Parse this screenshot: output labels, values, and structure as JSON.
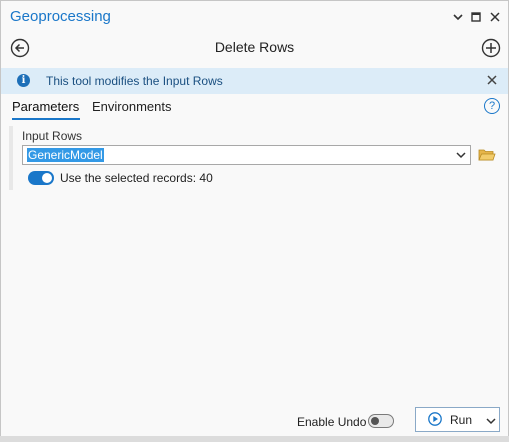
{
  "window": {
    "title": "Geoprocessing",
    "controls": [
      "chevron-down-icon",
      "maximize-icon",
      "close-icon"
    ]
  },
  "header": {
    "tool_title": "Delete Rows",
    "back_icon": "back-arrow-icon",
    "add_icon": "add-circle-icon"
  },
  "info": {
    "message": "This tool modifies the Input Rows",
    "icon": "info-icon"
  },
  "tabs": [
    {
      "label": "Parameters",
      "active": true
    },
    {
      "label": "Environments",
      "active": false
    }
  ],
  "params": {
    "input_rows_label": "Input Rows",
    "input_rows_value": "GenericModel",
    "use_selected_label": "Use the selected records: 40",
    "use_selected_on": true
  },
  "footer": {
    "enable_undo_label": "Enable Undo",
    "enable_undo_on": false,
    "run_label": "Run"
  },
  "colors": {
    "accent": "#1a77c9",
    "info_bg": "#dcecf8",
    "selection": "#3399e6"
  }
}
